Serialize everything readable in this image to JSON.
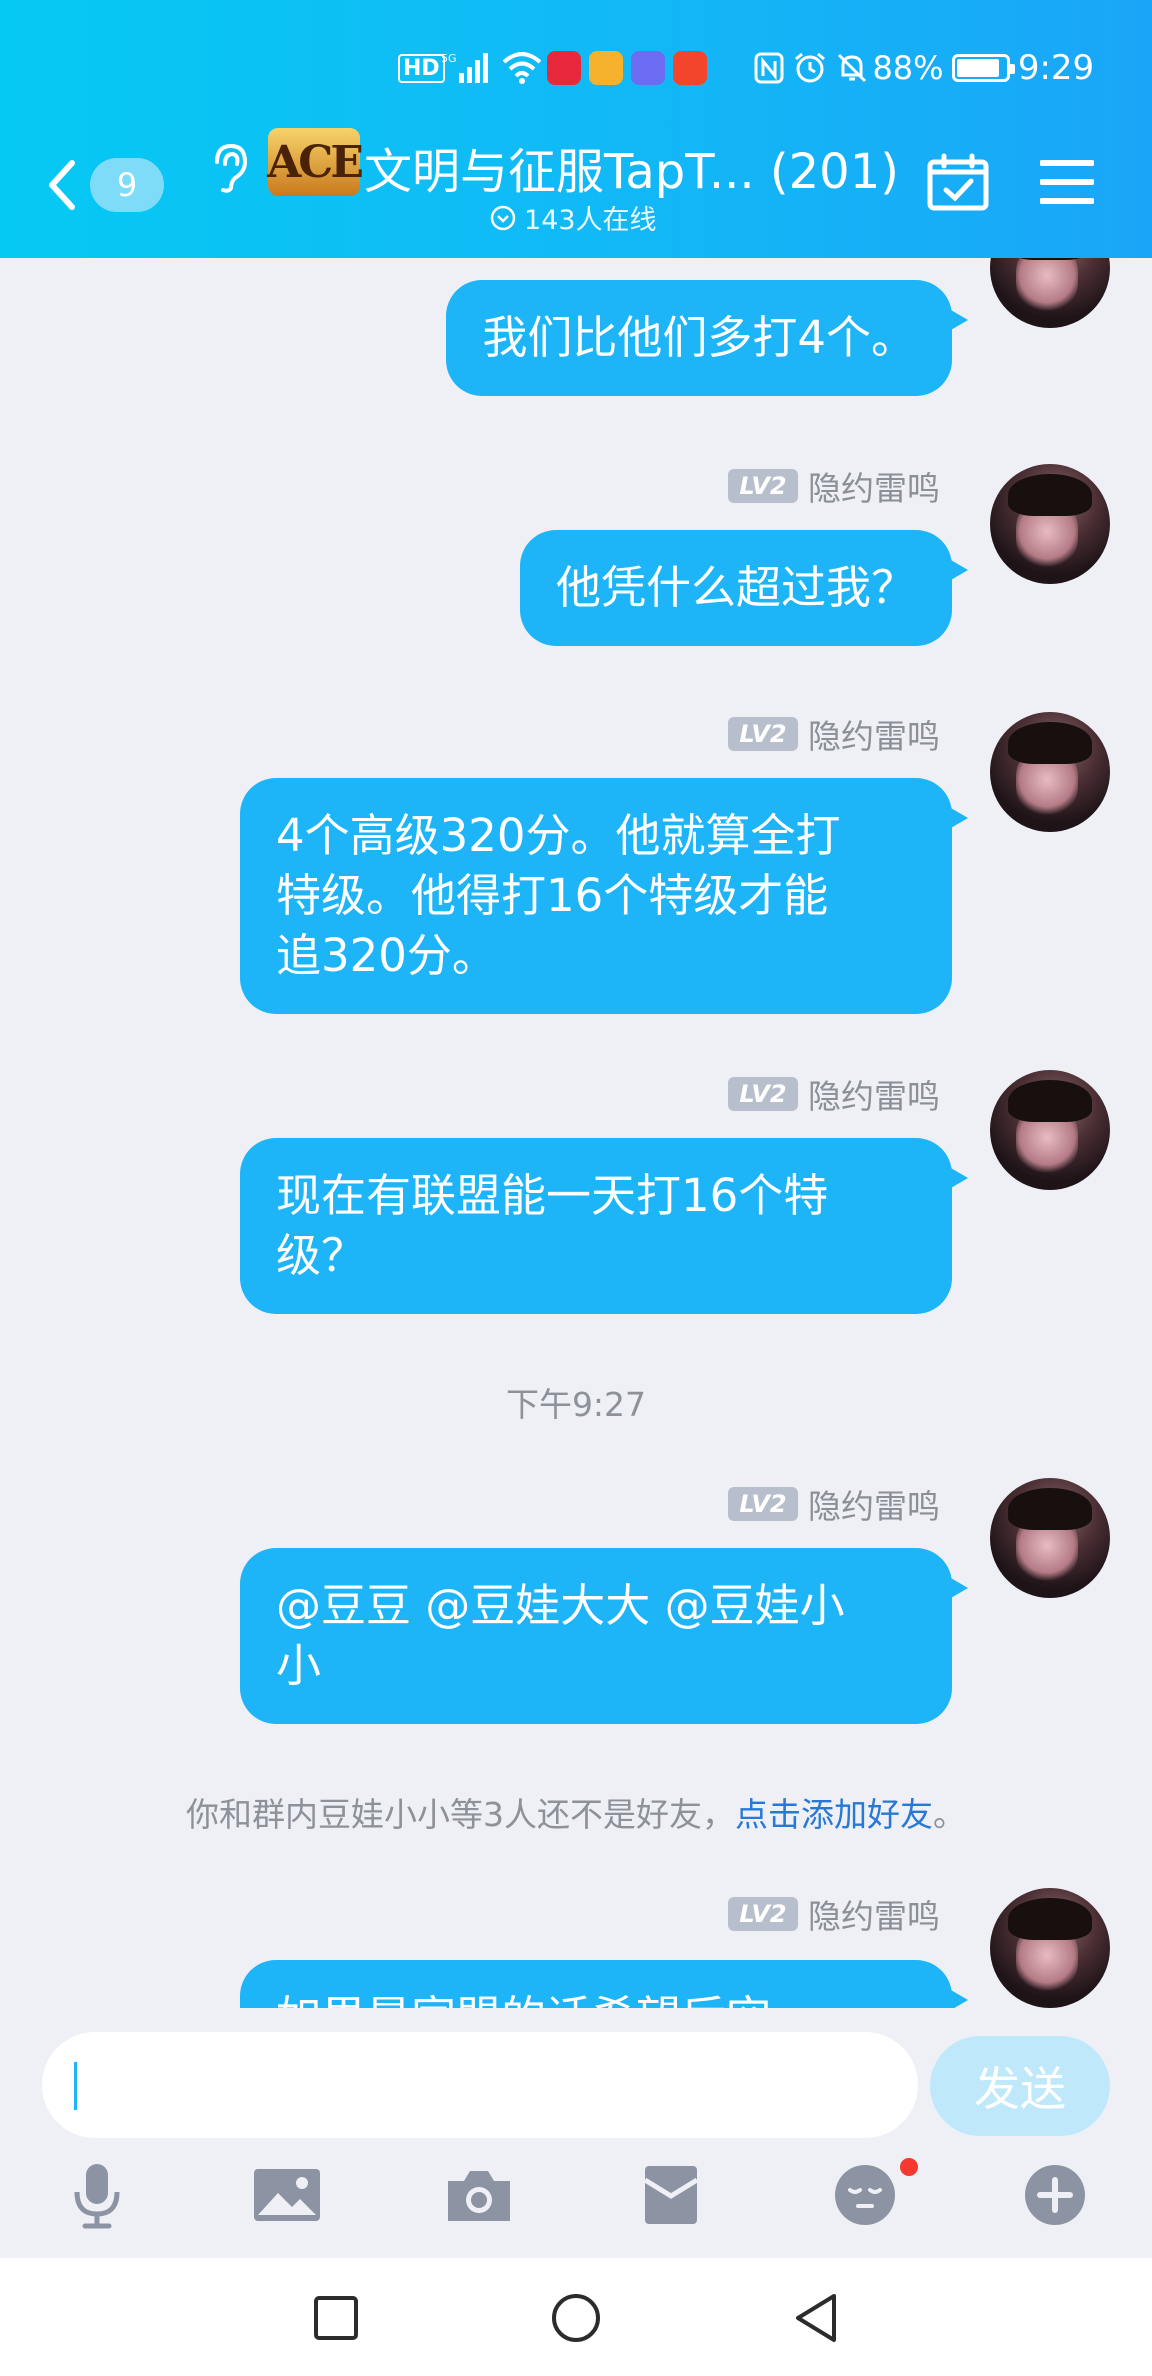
{
  "status_bar": {
    "hd": "HD",
    "network": "5G",
    "battery_percent": "88%",
    "battery_level": 0.88,
    "time": "9:29"
  },
  "header": {
    "unread_count": "9",
    "group_avatar_text": "ACE",
    "group_name": "文明与征服TapT... (201)",
    "online_status": "143人在线"
  },
  "messages": [
    {
      "sender": "",
      "text": "我们比他们多打4个。"
    },
    {
      "level": "LV2",
      "sender": "隐约雷鸣",
      "text": "他凭什么超过我？"
    },
    {
      "level": "LV2",
      "sender": "隐约雷鸣",
      "text_lines": [
        "4个高级320分。他就算全打",
        "特级。他得打16个特级才能",
        "追320分。"
      ]
    },
    {
      "level": "LV2",
      "sender": "隐约雷鸣",
      "text_lines": [
        "现在有联盟能一天打16个特",
        "级？"
      ]
    },
    {
      "level": "LV2",
      "sender": "隐约雷鸣",
      "text_lines": [
        "@豆豆 @豆娃大大 @豆娃小",
        "小"
      ]
    },
    {
      "level": "LV2",
      "sender": "隐约雷鸣",
      "text": "如果是家盟的话希望后空..."
    }
  ],
  "timestamp": "下午9:27",
  "notice": {
    "text": "你和群内豆娃小小等3人还不是好友，",
    "link": "点击添加好友",
    "end": "。"
  },
  "input": {
    "placeholder": "",
    "send_label": "发送"
  },
  "toolbar_icons": [
    "microphone-icon",
    "image-icon",
    "camera-icon",
    "red-packet-icon",
    "emoji-icon",
    "plus-icon"
  ],
  "colors": {
    "header_start": "#06c9f3",
    "header_end": "#1aa6f8",
    "bubble": "#1eb4f8",
    "link": "#2878d8",
    "background": "#eef0f5"
  }
}
